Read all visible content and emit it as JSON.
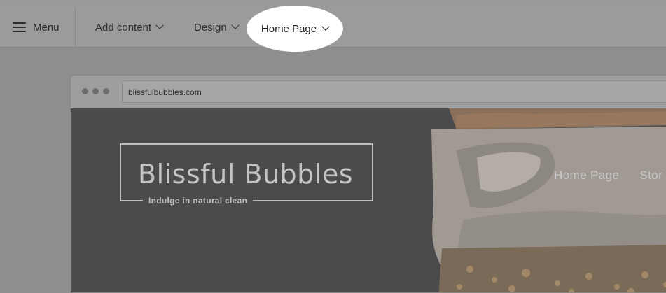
{
  "toolbar": {
    "menu_label": "Menu",
    "items": [
      {
        "label": "Add content"
      },
      {
        "label": "Design"
      },
      {
        "label": "Home Page"
      }
    ]
  },
  "browser": {
    "url": "blissfulbubbles.com"
  },
  "site": {
    "title": "Blissful Bubbles",
    "tagline": "Indulge in natural clean",
    "nav": [
      "Home Page",
      "Stor"
    ]
  },
  "colors": {
    "overlay_gray": "#8e8e8e",
    "site_background": "#4b4b4e",
    "spotlight": "#ffffff"
  },
  "icons": {
    "menu": "hamburger-icon",
    "dropdown": "chevron-down-icon"
  }
}
